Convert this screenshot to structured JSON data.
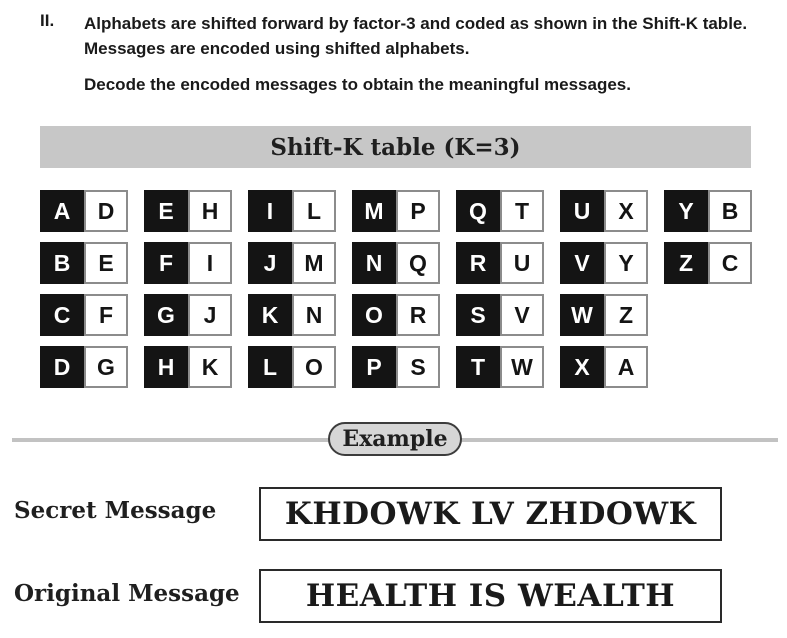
{
  "question": {
    "number": "II.",
    "text": "Alphabets are shifted forward by factor-3 and coded as shown in the Shift-K table. Messages are encoded using shifted alphabets.",
    "instruction": "Decode the encoded messages to obtain the meaningful messages."
  },
  "shift_table": {
    "title": "Shift-K table (K=3)",
    "columns": [
      [
        [
          "A",
          "D"
        ],
        [
          "B",
          "E"
        ],
        [
          "C",
          "F"
        ],
        [
          "D",
          "G"
        ]
      ],
      [
        [
          "E",
          "H"
        ],
        [
          "F",
          "I"
        ],
        [
          "G",
          "J"
        ],
        [
          "H",
          "K"
        ]
      ],
      [
        [
          "I",
          "L"
        ],
        [
          "J",
          "M"
        ],
        [
          "K",
          "N"
        ],
        [
          "L",
          "O"
        ]
      ],
      [
        [
          "M",
          "P"
        ],
        [
          "N",
          "Q"
        ],
        [
          "O",
          "R"
        ],
        [
          "P",
          "S"
        ]
      ],
      [
        [
          "Q",
          "T"
        ],
        [
          "R",
          "U"
        ],
        [
          "S",
          "V"
        ],
        [
          "T",
          "W"
        ]
      ],
      [
        [
          "U",
          "X"
        ],
        [
          "V",
          "Y"
        ],
        [
          "W",
          "Z"
        ],
        [
          "X",
          "A"
        ]
      ],
      [
        [
          "Y",
          "B"
        ],
        [
          "Z",
          "C"
        ]
      ]
    ]
  },
  "example": {
    "label": "Example",
    "secret_label": "Secret Message",
    "secret_value": "KHDOWK LV ZHDOWK",
    "original_label": "Original Message",
    "original_value": "HEALTH IS WEALTH"
  },
  "colors": {
    "source_cell": "#141414",
    "coded_cell_border": "#8c8c8c",
    "title_bar": "#c7c7c7",
    "example_pill": "#d6d6d6"
  }
}
